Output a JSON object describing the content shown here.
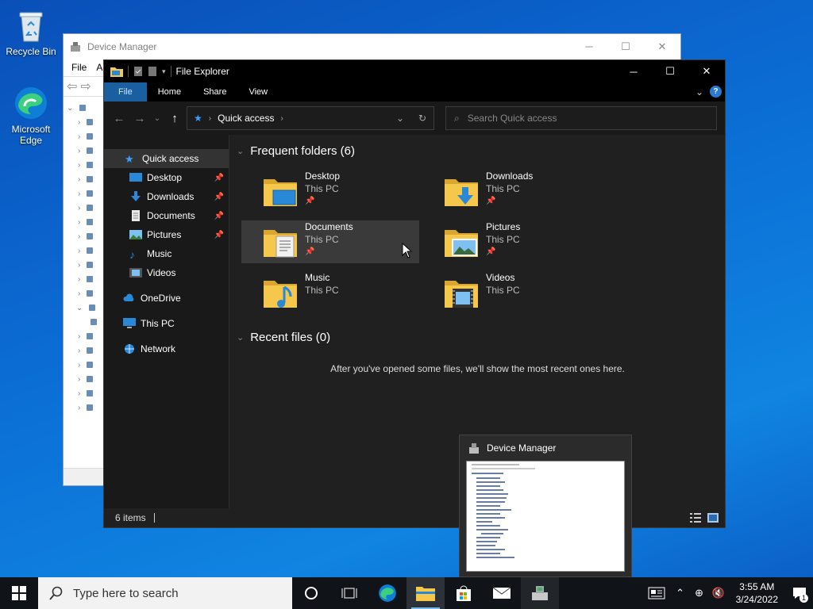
{
  "desktop": {
    "icons": [
      {
        "label": "Recycle Bin"
      },
      {
        "label": "Microsoft Edge"
      }
    ]
  },
  "device_manager": {
    "title": "Device Manager",
    "menu": [
      "File",
      "A"
    ],
    "thumbnail_title": "Device Manager"
  },
  "explorer": {
    "title": "File Explorer",
    "ribbon_tabs": [
      "File",
      "Home",
      "Share",
      "View"
    ],
    "help_label": "?",
    "address": {
      "location": "Quick access"
    },
    "search": {
      "placeholder": "Search Quick access"
    },
    "nav": {
      "quick_access": "Quick access",
      "pinned": [
        {
          "label": "Desktop",
          "pinned": true
        },
        {
          "label": "Downloads",
          "pinned": true
        },
        {
          "label": "Documents",
          "pinned": true
        },
        {
          "label": "Pictures",
          "pinned": true
        },
        {
          "label": "Music",
          "pinned": false
        },
        {
          "label": "Videos",
          "pinned": false
        }
      ],
      "onedrive": "OneDrive",
      "this_pc": "This PC",
      "network": "Network"
    },
    "frequent": {
      "heading": "Frequent folders (6)",
      "folders": [
        {
          "name": "Desktop",
          "location": "This PC",
          "pinned": true
        },
        {
          "name": "Downloads",
          "location": "This PC",
          "pinned": true
        },
        {
          "name": "Documents",
          "location": "This PC",
          "pinned": true
        },
        {
          "name": "Pictures",
          "location": "This PC",
          "pinned": true
        },
        {
          "name": "Music",
          "location": "This PC",
          "pinned": false
        },
        {
          "name": "Videos",
          "location": "This PC",
          "pinned": false
        }
      ]
    },
    "recent": {
      "heading": "Recent files (0)",
      "empty_message": "After you've opened some files, we'll show the most recent ones here."
    },
    "status": {
      "item_count": "6 items"
    }
  },
  "taskbar": {
    "search_placeholder": "Type here to search",
    "clock": {
      "time": "3:55 AM",
      "date": "3/24/2022"
    },
    "notification_count": "1"
  },
  "colors": {
    "accent": "#1a5fa0",
    "desktop_blue": "#0b6fd6",
    "explorer_bg": "#202020",
    "folder_yellow": "#f5c84c"
  }
}
